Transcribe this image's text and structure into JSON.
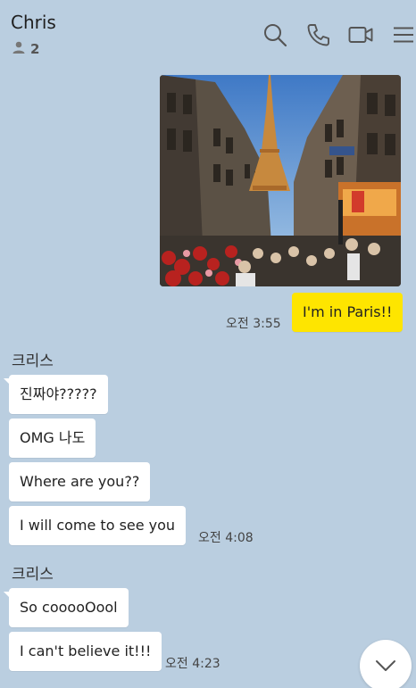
{
  "header": {
    "title": "Chris",
    "member_count": "2",
    "icons": [
      "person-icon",
      "search-icon",
      "phone-icon",
      "video-icon",
      "menu-icon"
    ]
  },
  "messages": {
    "photo_alt": "Eiffel Tower street photo",
    "mine_text": "I'm in Paris!!",
    "mine_time": "오전 3:55",
    "sender_1": "크리스",
    "m1": "진짜야?????",
    "m2": "OMG 나도",
    "m3": "Where are you??",
    "m4": "I will come to see you",
    "time_1": "오전 4:08",
    "sender_2": "크리스",
    "m5": "So cooooOool",
    "m6": "I can't believe it!!!",
    "time_2": "오전 4:23"
  },
  "colors": {
    "background": "#bacee0",
    "mine_bubble": "#fee500",
    "other_bubble": "#ffffff"
  },
  "scroll_button_icon": "chevron-down-icon"
}
